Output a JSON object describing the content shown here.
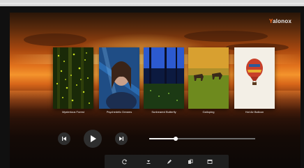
{
  "brand": {
    "prefix": "Y",
    "name": "alonox"
  },
  "gallery": {
    "items": [
      {
        "title": "Mysterious Forest"
      },
      {
        "title": "Psychedelic Dreams"
      },
      {
        "title": "Sunbeared Butterfly"
      },
      {
        "title": "Galloping"
      },
      {
        "title": "Hot Air Balloon"
      }
    ]
  },
  "player": {
    "progress": 0.25,
    "controls": [
      "skip-back",
      "play",
      "skip-forward"
    ]
  },
  "toolbar": {
    "icons": [
      "rotate-icon",
      "download-icon",
      "edit-icon",
      "copy-icon",
      "window-icon"
    ]
  },
  "colors": {
    "brand_accent": "#ff6a1a",
    "progress_fill": "#f0f0f0",
    "control_bg": "#2e2e2e"
  }
}
